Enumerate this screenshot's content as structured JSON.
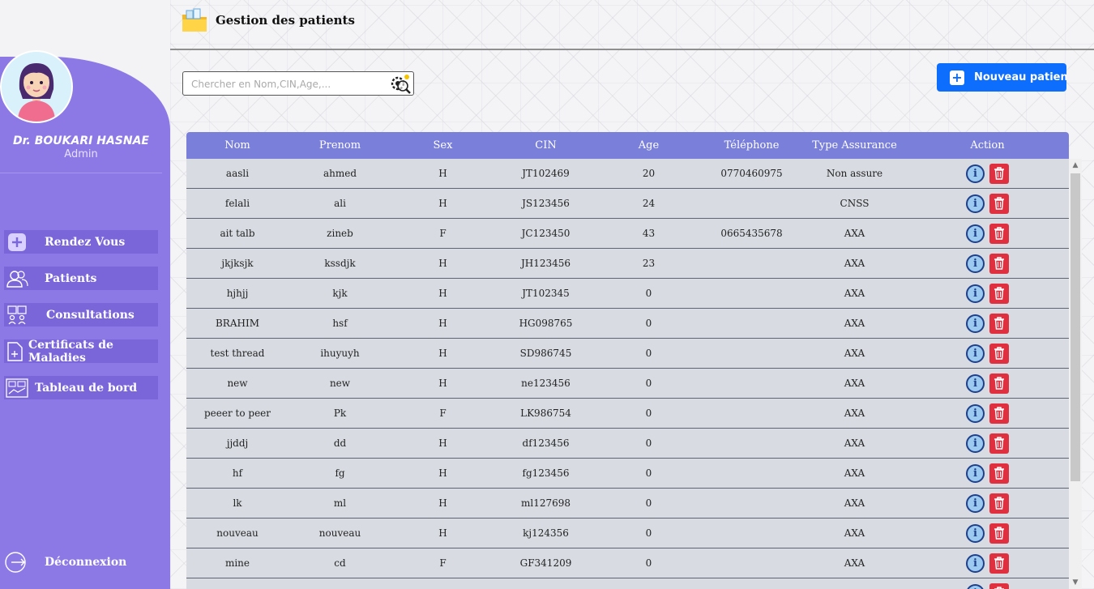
{
  "sidebar": {
    "doctor_name": "Dr. BOUKARI HASNAE",
    "role": "Admin",
    "items": [
      {
        "label": "Rendez Vous",
        "icon": "plus-square-icon"
      },
      {
        "label": "Patients",
        "icon": "users-icon"
      },
      {
        "label": "Consultations",
        "icon": "consultation-icon"
      },
      {
        "label": "Certificats de Maladies",
        "icon": "certificate-icon"
      },
      {
        "label": "Tableau de bord",
        "icon": "dashboard-icon"
      }
    ],
    "logout_label": "Déconnexion"
  },
  "header": {
    "title": "Gestion des patients",
    "icon": "folder-icon"
  },
  "search": {
    "placeholder": "Chercher en Nom,CIN,Age,...",
    "value": ""
  },
  "new_patient_button": "Nouveau patient",
  "table": {
    "columns": [
      "Nom",
      "Prenom",
      "Sex",
      "CIN",
      "Age",
      "Téléphone",
      "Type Assurance",
      "Action"
    ],
    "rows": [
      {
        "nom": "aasli",
        "prenom": "ahmed",
        "sex": "H",
        "cin": "JT102469",
        "age": "20",
        "tel": "0770460975",
        "assurance": "Non assure"
      },
      {
        "nom": "felali",
        "prenom": "ali",
        "sex": "H",
        "cin": "JS123456",
        "age": "24",
        "tel": "",
        "assurance": "CNSS"
      },
      {
        "nom": "ait talb",
        "prenom": "zineb",
        "sex": "F",
        "cin": "JC123450",
        "age": "43",
        "tel": "0665435678",
        "assurance": "AXA"
      },
      {
        "nom": "jkjksjk",
        "prenom": "kssdjk",
        "sex": "H",
        "cin": "JH123456",
        "age": "23",
        "tel": "",
        "assurance": "AXA"
      },
      {
        "nom": "hjhjj",
        "prenom": "kjk",
        "sex": "H",
        "cin": "JT102345",
        "age": "0",
        "tel": "",
        "assurance": "AXA"
      },
      {
        "nom": "BRAHIM",
        "prenom": "hsf",
        "sex": "H",
        "cin": "HG098765",
        "age": "0",
        "tel": "",
        "assurance": "AXA"
      },
      {
        "nom": "test thread",
        "prenom": "ihuyuyh",
        "sex": "H",
        "cin": "SD986745",
        "age": "0",
        "tel": "",
        "assurance": "AXA"
      },
      {
        "nom": "new",
        "prenom": "new",
        "sex": "H",
        "cin": "ne123456",
        "age": "0",
        "tel": "",
        "assurance": "AXA"
      },
      {
        "nom": "peeer to peer",
        "prenom": "Pk",
        "sex": "F",
        "cin": "LK986754",
        "age": "0",
        "tel": "",
        "assurance": "AXA"
      },
      {
        "nom": "jjddj",
        "prenom": "dd",
        "sex": "H",
        "cin": "df123456",
        "age": "0",
        "tel": "",
        "assurance": "AXA"
      },
      {
        "nom": "hf",
        "prenom": "fg",
        "sex": "H",
        "cin": "fg123456",
        "age": "0",
        "tel": "",
        "assurance": "AXA"
      },
      {
        "nom": "lk",
        "prenom": "ml",
        "sex": "H",
        "cin": "ml127698",
        "age": "0",
        "tel": "",
        "assurance": "AXA"
      },
      {
        "nom": "nouveau",
        "prenom": "nouveau",
        "sex": "H",
        "cin": "kj124356",
        "age": "0",
        "tel": "",
        "assurance": "AXA"
      },
      {
        "nom": "mine",
        "prenom": "cd",
        "sex": "F",
        "cin": "GF341209",
        "age": "0",
        "tel": "",
        "assurance": "AXA"
      },
      {
        "nom": "",
        "prenom": "",
        "sex": "",
        "cin": "",
        "age": "",
        "tel": "",
        "assurance": ""
      }
    ]
  },
  "colors": {
    "sidebar": "#8d79e6",
    "nav_item": "#7b66d9",
    "table_header": "#7a80da",
    "table_body": "#d8dce2",
    "primary_button": "#0d6efd",
    "delete": "#e0303f",
    "info": "#9cc9ef"
  }
}
